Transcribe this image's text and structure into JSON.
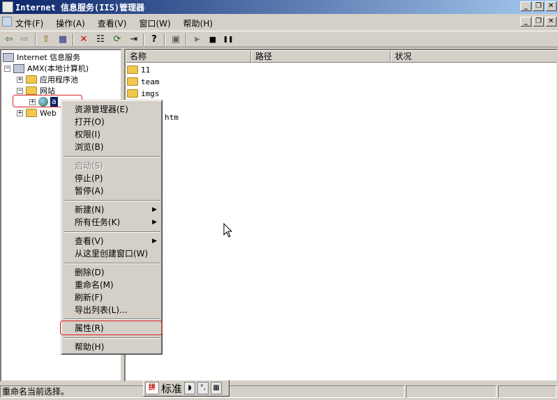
{
  "window": {
    "title": "Internet 信息服务(IIS)管理器",
    "controls": [
      "_",
      "❐",
      "✕"
    ]
  },
  "menubar": {
    "items": [
      "文件(F)",
      "操作(A)",
      "查看(V)",
      "窗口(W)",
      "帮助(H)"
    ]
  },
  "toolbar": {
    "icons": [
      "back-icon",
      "forward-icon",
      "up-folder-icon",
      "show-tree-icon",
      "delete-icon",
      "properties-icon",
      "refresh-icon",
      "export-list-icon",
      "help-icon",
      "computer-icon",
      "play-icon",
      "stop-icon",
      "pause-icon"
    ],
    "glyphs": {
      "back": "⇦",
      "forward": "⇨",
      "up": "⇧",
      "tree": "▦",
      "delete": "✕",
      "props": "☷",
      "refresh": "⟳",
      "export": "⇥",
      "help": "?",
      "computer": "▣",
      "play": "▶",
      "stop": "■",
      "pause": "❚❚"
    }
  },
  "tree": {
    "root": "Internet 信息服务",
    "computer": "AMX(本地计算机)",
    "app_pools": "应用程序池",
    "websites": "网站",
    "site": "a",
    "web_ext": "Web",
    "expander_plus": "+",
    "expander_minus": "−"
  },
  "list": {
    "columns": [
      "名称",
      "路径",
      "状况"
    ],
    "files": [
      "11",
      "team",
      "imgs"
    ],
    "partial_file": "htm"
  },
  "context_menu": {
    "items": [
      {
        "label": "资源管理器(E)",
        "disabled": false
      },
      {
        "label": "打开(O)",
        "disabled": false
      },
      {
        "label": "权限(I)",
        "disabled": false
      },
      {
        "label": "浏览(B)",
        "disabled": false
      },
      {
        "label": "启动(S)",
        "disabled": true
      },
      {
        "label": "停止(P)",
        "disabled": false
      },
      {
        "label": "暂停(A)",
        "disabled": false
      },
      {
        "label": "新建(N)",
        "disabled": false,
        "submenu": true
      },
      {
        "label": "所有任务(K)",
        "disabled": false,
        "submenu": true
      },
      {
        "label": "查看(V)",
        "disabled": false,
        "submenu": true
      },
      {
        "label": "从这里创建窗口(W)",
        "disabled": false
      },
      {
        "label": "删除(D)",
        "disabled": false
      },
      {
        "label": "重命名(M)",
        "disabled": false
      },
      {
        "label": "刷新(F)",
        "disabled": false
      },
      {
        "label": "导出列表(L)...",
        "disabled": false
      },
      {
        "label": "属性(R)",
        "disabled": false,
        "highlighted_box": true
      },
      {
        "label": "帮助(H)",
        "disabled": false
      }
    ],
    "submenu_arrow": "▶"
  },
  "statusbar": {
    "message": "重命名当前选择。"
  },
  "ime": {
    "logo": "拼",
    "mode": "标准",
    "moon": "◗",
    "punct": "°,",
    "keyboard": "▦"
  },
  "colors": {
    "title_gradient_start": "#0a246a",
    "title_gradient_end": "#a6caf0",
    "highlight_box": "#e02020",
    "face": "#d4d0c8"
  }
}
